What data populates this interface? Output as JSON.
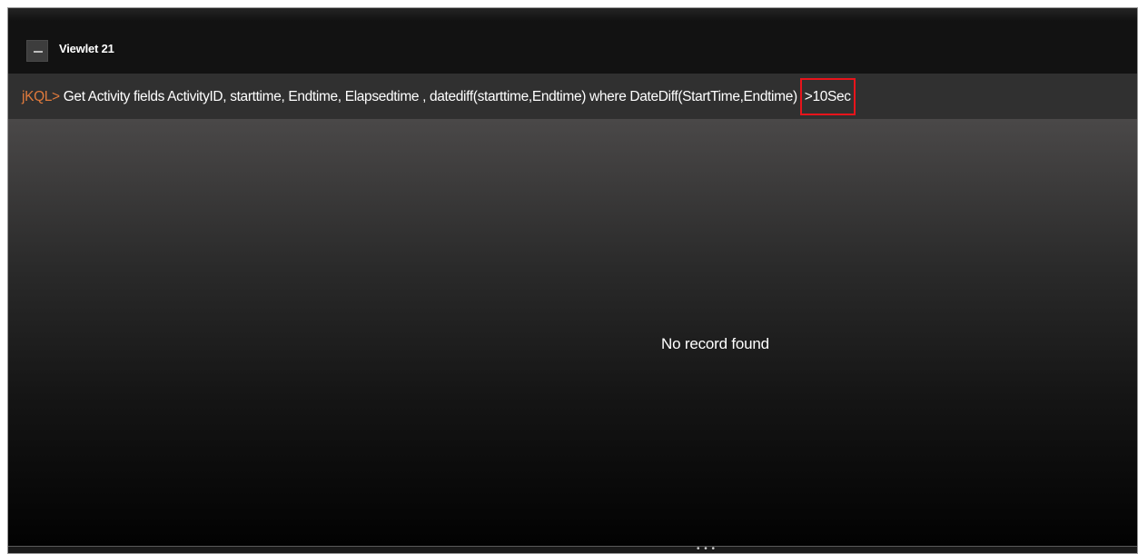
{
  "viewlet": {
    "title": "Viewlet 21",
    "collapse_icon": "minus-icon"
  },
  "query": {
    "prompt": "jKQL>",
    "text": " Get Activity fields   ActivityID, starttime, Endtime, Elapsedtime ,  datediff(starttime,Endtime) where DateDiff(StartTime,Endtime) ",
    "highlighted": ">10Sec",
    "highlight_color": "#e8141b"
  },
  "results": {
    "empty_message": "No record found"
  },
  "resize_handle": {
    "glyph": "• • •",
    "icon": "resize-handle-icon"
  },
  "colors": {
    "prompt": "#e07a3c",
    "querybar_bg": "#303030",
    "title_bg": "#121212"
  }
}
